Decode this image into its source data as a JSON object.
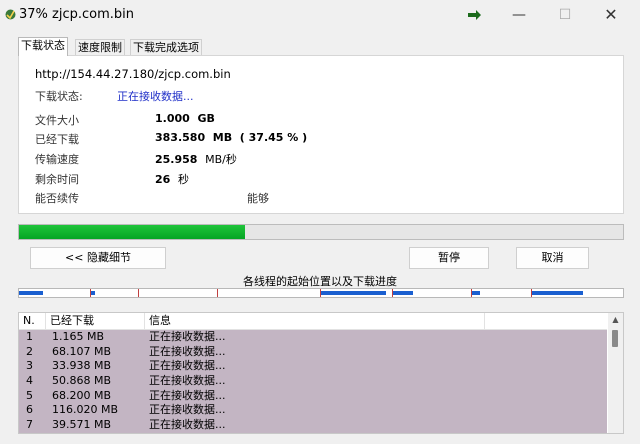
{
  "window": {
    "title": "37% zjcp.com.bin",
    "minimize": "—",
    "maximize": "☐",
    "close": "✕"
  },
  "tabs": [
    "下载状态",
    "速度限制",
    "下载完成选项"
  ],
  "details": {
    "url": "http://154.44.27.180/zjcp.com.bin",
    "status_label": "下载状态:",
    "status_value": "正在接收数据...",
    "file_size_label": "文件大小",
    "file_size_value": "1.000",
    "file_size_unit": "GB",
    "downloaded_label": "已经下载",
    "downloaded_value": "383.580",
    "downloaded_unit": "MB",
    "downloaded_percent": "( 37.45 % )",
    "speed_label": "传输速度",
    "speed_value": "25.958",
    "speed_unit": "MB/秒",
    "remaining_label": "剩余时间",
    "remaining_value": "26",
    "remaining_unit": "秒",
    "resume_label": "能否续传",
    "resume_value": "能够"
  },
  "progress": {
    "fraction": 0.3745,
    "color": "#11b52e"
  },
  "buttons": {
    "hide_details": "<< 隐藏细节",
    "pause": "暂停",
    "cancel": "取消"
  },
  "segments": {
    "caption": "各线程的起始位置以及下载进度",
    "items": [
      {
        "fraction": 0.12,
        "done": 0.333
      },
      {
        "fraction": 0.08,
        "done": 0.083
      },
      {
        "fraction": 0.13,
        "done": 0.0
      },
      {
        "fraction": 0.17,
        "done": 0.0
      },
      {
        "fraction": 0.12,
        "done": 0.9
      },
      {
        "fraction": 0.13,
        "done": 0.25
      },
      {
        "fraction": 0.1,
        "done": 0.14
      },
      {
        "fraction": 0.15,
        "done": 0.56
      }
    ],
    "fill_color": "#1a5fd0"
  },
  "table": {
    "columns": [
      "N.",
      "已经下载",
      "信息",
      ""
    ],
    "rows": [
      {
        "n": "1",
        "size": "1.165  MB",
        "info": "正在接收数据..."
      },
      {
        "n": "2",
        "size": "68.107  MB",
        "info": "正在接收数据..."
      },
      {
        "n": "3",
        "size": "33.938  MB",
        "info": "正在接收数据..."
      },
      {
        "n": "4",
        "size": "50.868  MB",
        "info": "正在接收数据..."
      },
      {
        "n": "5",
        "size": "68.200  MB",
        "info": "正在接收数据..."
      },
      {
        "n": "6",
        "size": "116.020  MB",
        "info": "正在接收数据..."
      },
      {
        "n": "7",
        "size": "39.571  MB",
        "info": "正在接收数据..."
      }
    ],
    "row_color": "#c3b5c3"
  }
}
